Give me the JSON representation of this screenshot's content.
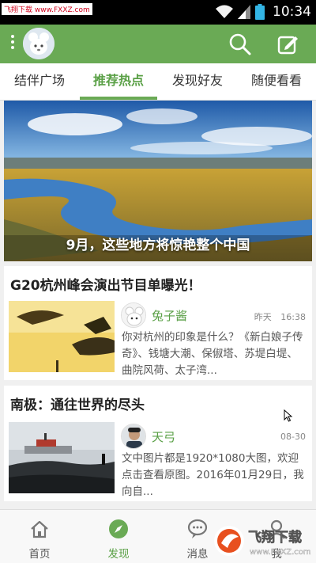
{
  "status_bar": {
    "watermark": "飞翔下载 www.FXXZ.com",
    "time": "10:34"
  },
  "app_bar": {
    "menu_icon": "overflow-menu-icon",
    "avatar_icon": "user-avatar",
    "search_icon": "search-icon",
    "compose_icon": "edit-icon"
  },
  "tabs": [
    {
      "label": "结伴广场"
    },
    {
      "label": "推荐热点",
      "active": true
    },
    {
      "label": "发现好友"
    },
    {
      "label": "随便看看"
    }
  ],
  "banner": {
    "caption": "9月，这些地方将惊艳整个中国"
  },
  "articles": [
    {
      "title": "G20杭州峰会演出节目单曝光！",
      "author": "兔子酱",
      "date": "昨天",
      "time": "16:38",
      "summary": "你对杭州的印象是什么？《新白娘子传奇》、钱塘大潮、保俶塔、苏堤白堤、曲院风荷、太子湾..."
    },
    {
      "title": "南极：通往世界的尽头",
      "author": "天弓",
      "date": "08-30",
      "summary": "文中图片都是1920*1080大图，欢迎点击查看原图。2016年01月29日，我向自..."
    }
  ],
  "bottom_nav": [
    {
      "label": "首页",
      "icon": "home-icon"
    },
    {
      "label": "发现",
      "icon": "compass-icon",
      "active": true
    },
    {
      "label": "消息",
      "icon": "message-icon"
    },
    {
      "label": "我",
      "icon": "profile-icon"
    }
  ],
  "corner_logo_text": "飞翔下载",
  "corner_logo_url": "www.FXXZ.com",
  "colors": {
    "brand_green": "#6aaa55",
    "active_text": "#5aa046",
    "status_bar": "#000000"
  }
}
